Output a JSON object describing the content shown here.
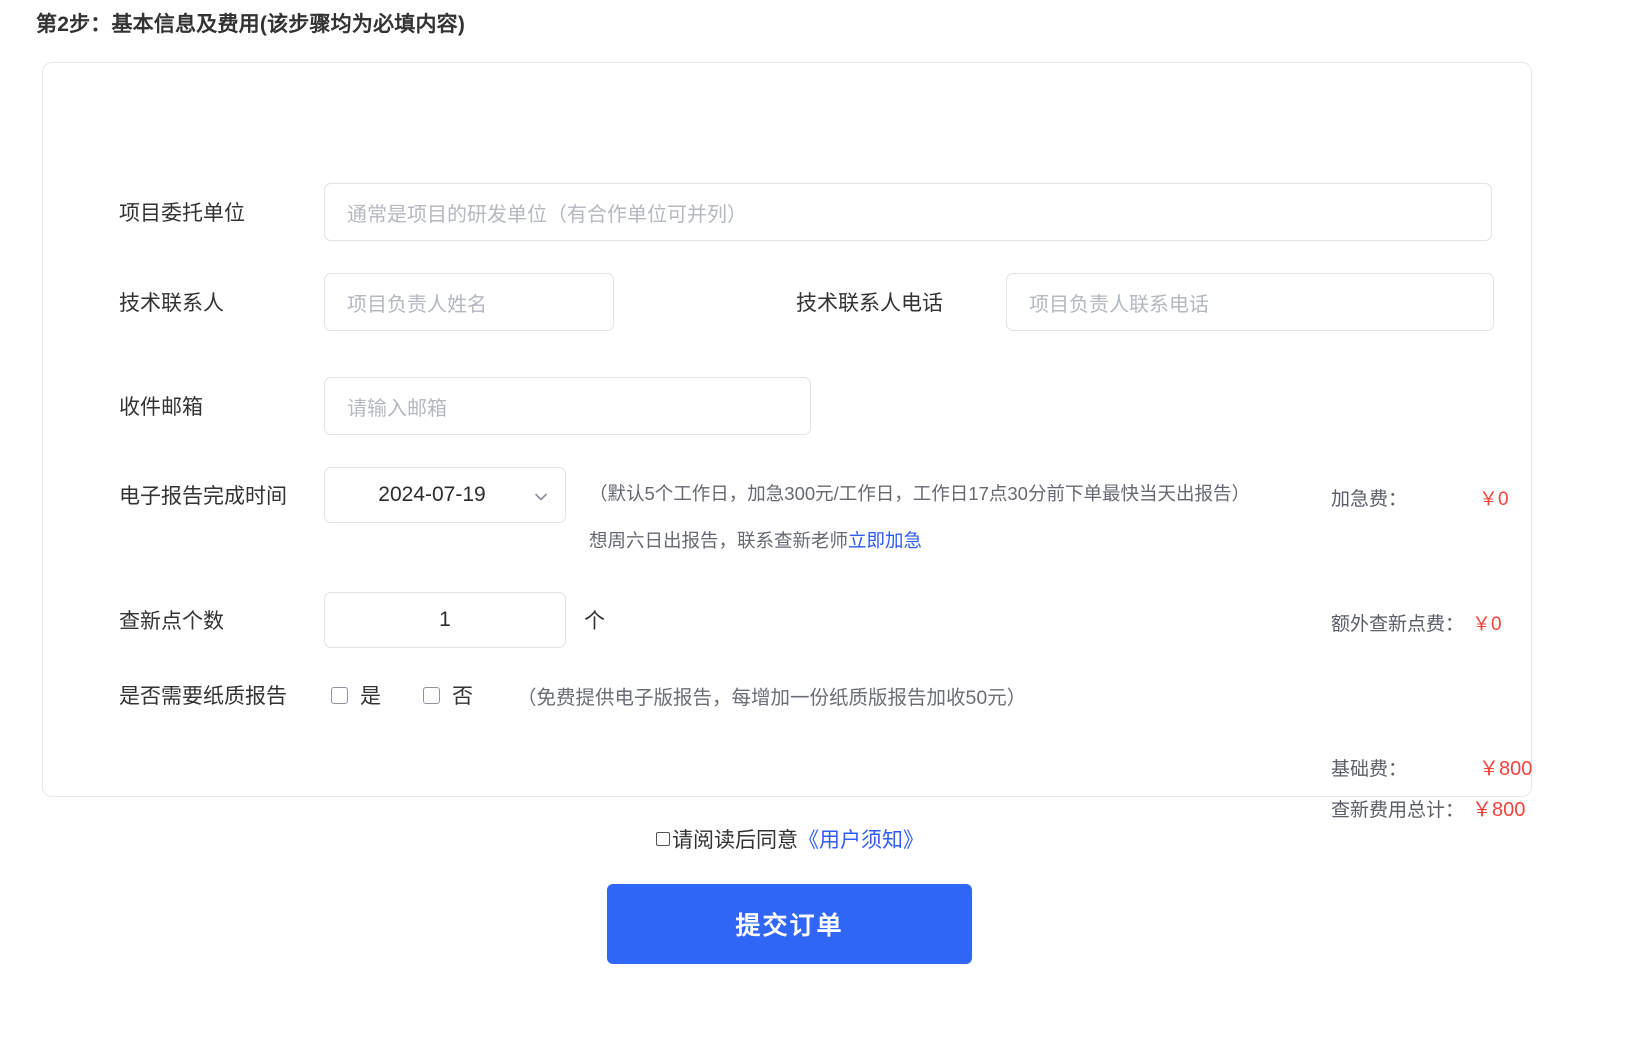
{
  "step": {
    "title": "第2步：基本信息及费用(该步骤均为必填内容)"
  },
  "form": {
    "client": {
      "label": "项目委托单位",
      "value": "",
      "placeholder": "通常是项目的研发单位（有合作单位可并列）"
    },
    "contact_name": {
      "label": "技术联系人",
      "value": "",
      "placeholder": "项目负责人姓名"
    },
    "contact_phone": {
      "label": "技术联系人电话",
      "value": "",
      "placeholder": "项目负责人联系电话"
    },
    "email": {
      "label": "收件邮箱",
      "value": "",
      "placeholder": "请输入邮箱"
    },
    "report_date": {
      "label": "电子报告完成时间",
      "value": "2024-07-19",
      "chevron_icon": "chevron-down-icon",
      "hint_line1": "（默认5个工作日，加急300元/工作日，工作日17点30分前下单最快当天出报告）",
      "hint_line2_prefix": "想周六日出报告，联系查新老师",
      "hint_line2_link": "立即加急"
    },
    "points": {
      "label": "查新点个数",
      "value": "1",
      "unit": "个"
    },
    "paper_report": {
      "label": "是否需要纸质报告",
      "option_yes": "是",
      "option_no": "否",
      "yes_checked": false,
      "no_checked": false,
      "note": "（免费提供电子版报告，每增加一份纸质版报告加收50元）"
    }
  },
  "fees": {
    "rush": {
      "label": "加急费：",
      "value": "￥0"
    },
    "extra_points": {
      "label": "额外查新点费：",
      "value": "￥0"
    },
    "base": {
      "label": "基础费：",
      "value": "￥800"
    },
    "total": {
      "label": "查新费用总计：",
      "value": "￥800"
    },
    "currency_color": "#f4433c"
  },
  "agreement": {
    "checked": false,
    "text": "请阅读后同意",
    "doc_link": "《用户须知》"
  },
  "submit": {
    "label": "提交订单",
    "color": "#2f66f5"
  }
}
